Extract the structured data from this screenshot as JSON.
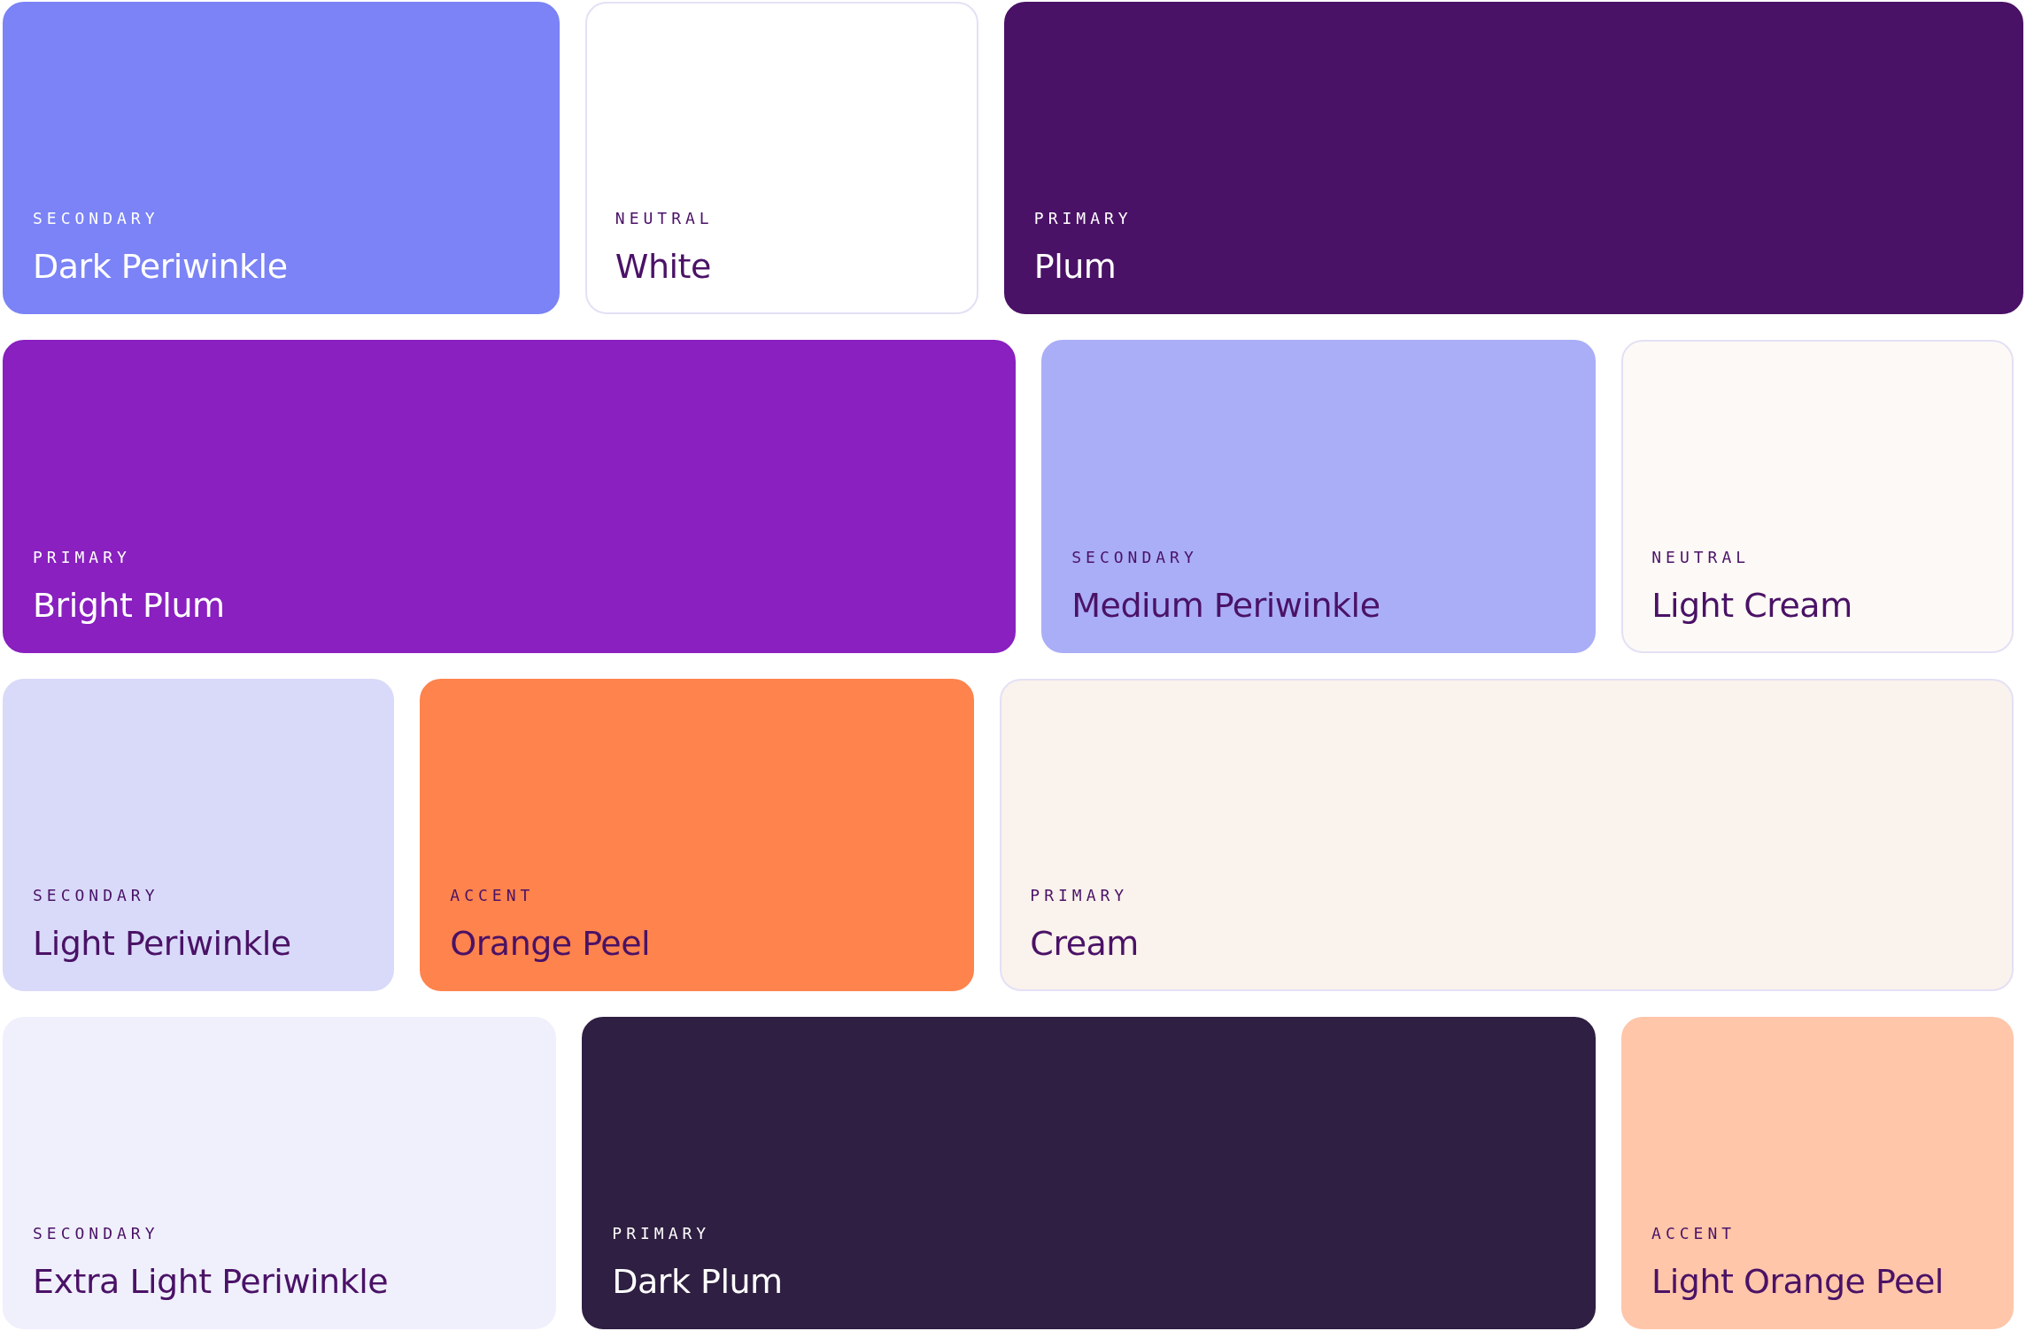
{
  "rows": [
    {
      "swatches": [
        {
          "category": "SECONDARY",
          "name": "Dark Periwinkle",
          "color": "#7b83f6"
        },
        {
          "category": "NEUTRAL",
          "name": "White",
          "color": "#ffffff"
        },
        {
          "category": "PRIMARY",
          "name": "Plum",
          "color": "#4a1266"
        }
      ]
    },
    {
      "swatches": [
        {
          "category": "PRIMARY",
          "name": "Bright Plum",
          "color": "#8920bf"
        },
        {
          "category": "SECONDARY",
          "name": "Medium Periwinkle",
          "color": "#aaaef7"
        },
        {
          "category": "NEUTRAL",
          "name": "Light Cream",
          "color": "#fdf9f6"
        }
      ]
    },
    {
      "swatches": [
        {
          "category": "SECONDARY",
          "name": "Light Periwinkle",
          "color": "#d9daf9"
        },
        {
          "category": "ACCENT",
          "name": "Orange Peel",
          "color": "#fe834d"
        },
        {
          "category": "PRIMARY",
          "name": "Cream",
          "color": "#faf2ec"
        }
      ]
    },
    {
      "swatches": [
        {
          "category": "SECONDARY",
          "name": "Extra Light Periwinkle",
          "color": "#f0f0fd"
        },
        {
          "category": "PRIMARY",
          "name": "Dark Plum",
          "color": "#2f1f42"
        },
        {
          "category": "ACCENT",
          "name": "Light Orange Peel",
          "color": "#ffc6aa"
        }
      ]
    }
  ]
}
